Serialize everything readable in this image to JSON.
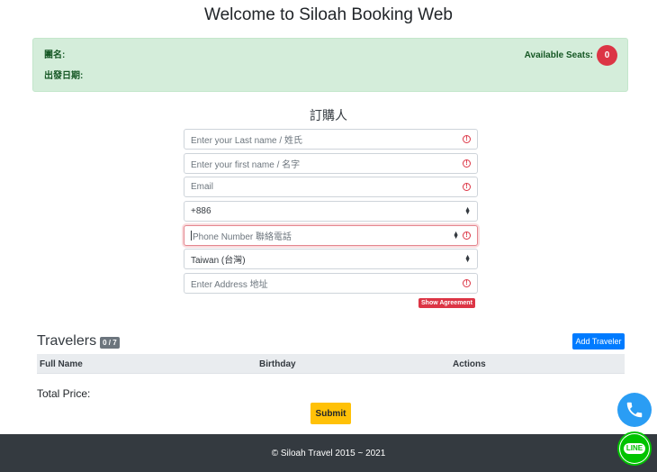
{
  "header": {
    "title": "Welcome to Siloah Booking Web"
  },
  "info_panel": {
    "group_label": "團名:",
    "date_label": "出發日期:",
    "seats_label": "Available Seats:",
    "seats_count": "0"
  },
  "booker": {
    "heading": "訂購人",
    "last_name_placeholder": "Enter your Last name / 姓氏",
    "first_name_placeholder": "Enter your first name / 名字",
    "email_placeholder": "Email",
    "country_code_value": "+886",
    "phone_placeholder": "Phone Number 聯絡電話",
    "country_value": "Taiwan (台灣)",
    "address_placeholder": "Enter Address 地址",
    "agreement_label": "Show Agreement"
  },
  "travelers": {
    "title": "Travelers",
    "count": "0 / 7",
    "add_label": "Add Traveler",
    "columns": [
      "Full Name",
      "Birthday",
      "Actions"
    ]
  },
  "total_price_label": "Total Price:",
  "submit_label": "Submit",
  "footer": {
    "text": "© Siloah Travel 2015 ~ 2021"
  },
  "floating": {
    "phone_icon": "phone-icon",
    "line_label": "LINE"
  },
  "colors": {
    "success_bg": "#d4edda",
    "danger": "#dc3545",
    "primary": "#007bff",
    "warning": "#ffc107",
    "footer_bg": "#343a40",
    "line_green": "#00c300"
  }
}
